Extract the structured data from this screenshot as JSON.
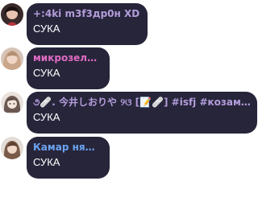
{
  "messages": [
    {
      "sender": "+:4ki m3f3др0н XD",
      "sender_color": "#b39ddb",
      "text": "СУКА",
      "avatar": "dark-hair-avatar"
    },
    {
      "sender": "микрозелень",
      "sender_color": "#e06bc4",
      "text": "СУКА",
      "avatar": "light-hair-avatar"
    },
    {
      "sender": "૭🩹. 今井しおりや ୨ଓ [📝🩹] #isfj #козамо…",
      "sender_color": "#b39ddb",
      "text": "СУКА",
      "avatar": "anime-avatar"
    },
    {
      "sender": "Камар няшка",
      "sender_color": "#6ba3f0",
      "text": "СУКА",
      "avatar": "brown-hair-avatar"
    }
  ]
}
